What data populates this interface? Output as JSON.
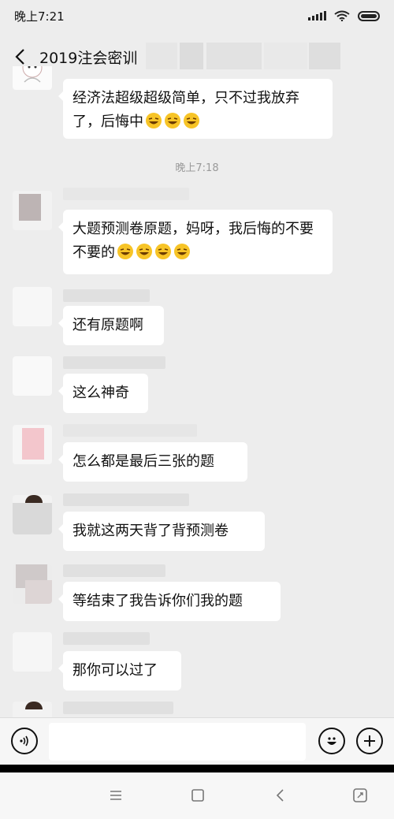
{
  "status": {
    "time": "晚上7:21"
  },
  "header": {
    "title": "2019注会密训"
  },
  "messages": [
    {
      "text": "经济法超级超级简单，只不过我放弃了，后悔中"
    },
    {
      "text": "大题预测卷原题，妈呀，我后悔的不要不要的"
    },
    {
      "text": "还有原题啊"
    },
    {
      "text": "这么神奇"
    },
    {
      "text": "怎么都是最后三张的题"
    },
    {
      "text": "我就这两天背了背预测卷"
    },
    {
      "text": "等结束了我告诉你们我的题"
    },
    {
      "text": "那你可以过了"
    }
  ],
  "timestamp": "晚上7:18",
  "composer": {
    "placeholder": ""
  },
  "icons": {
    "back": "chevron-left-icon",
    "voice": "voice-icon",
    "emoji": "smiley-icon",
    "add": "plus-icon",
    "menu": "menu-icon",
    "home": "square-icon",
    "navback": "nav-back-icon",
    "expand": "expand-icon"
  },
  "colors": {
    "background": "#ededed",
    "bubble": "#ffffff",
    "timestamp": "#9a9a9a"
  }
}
